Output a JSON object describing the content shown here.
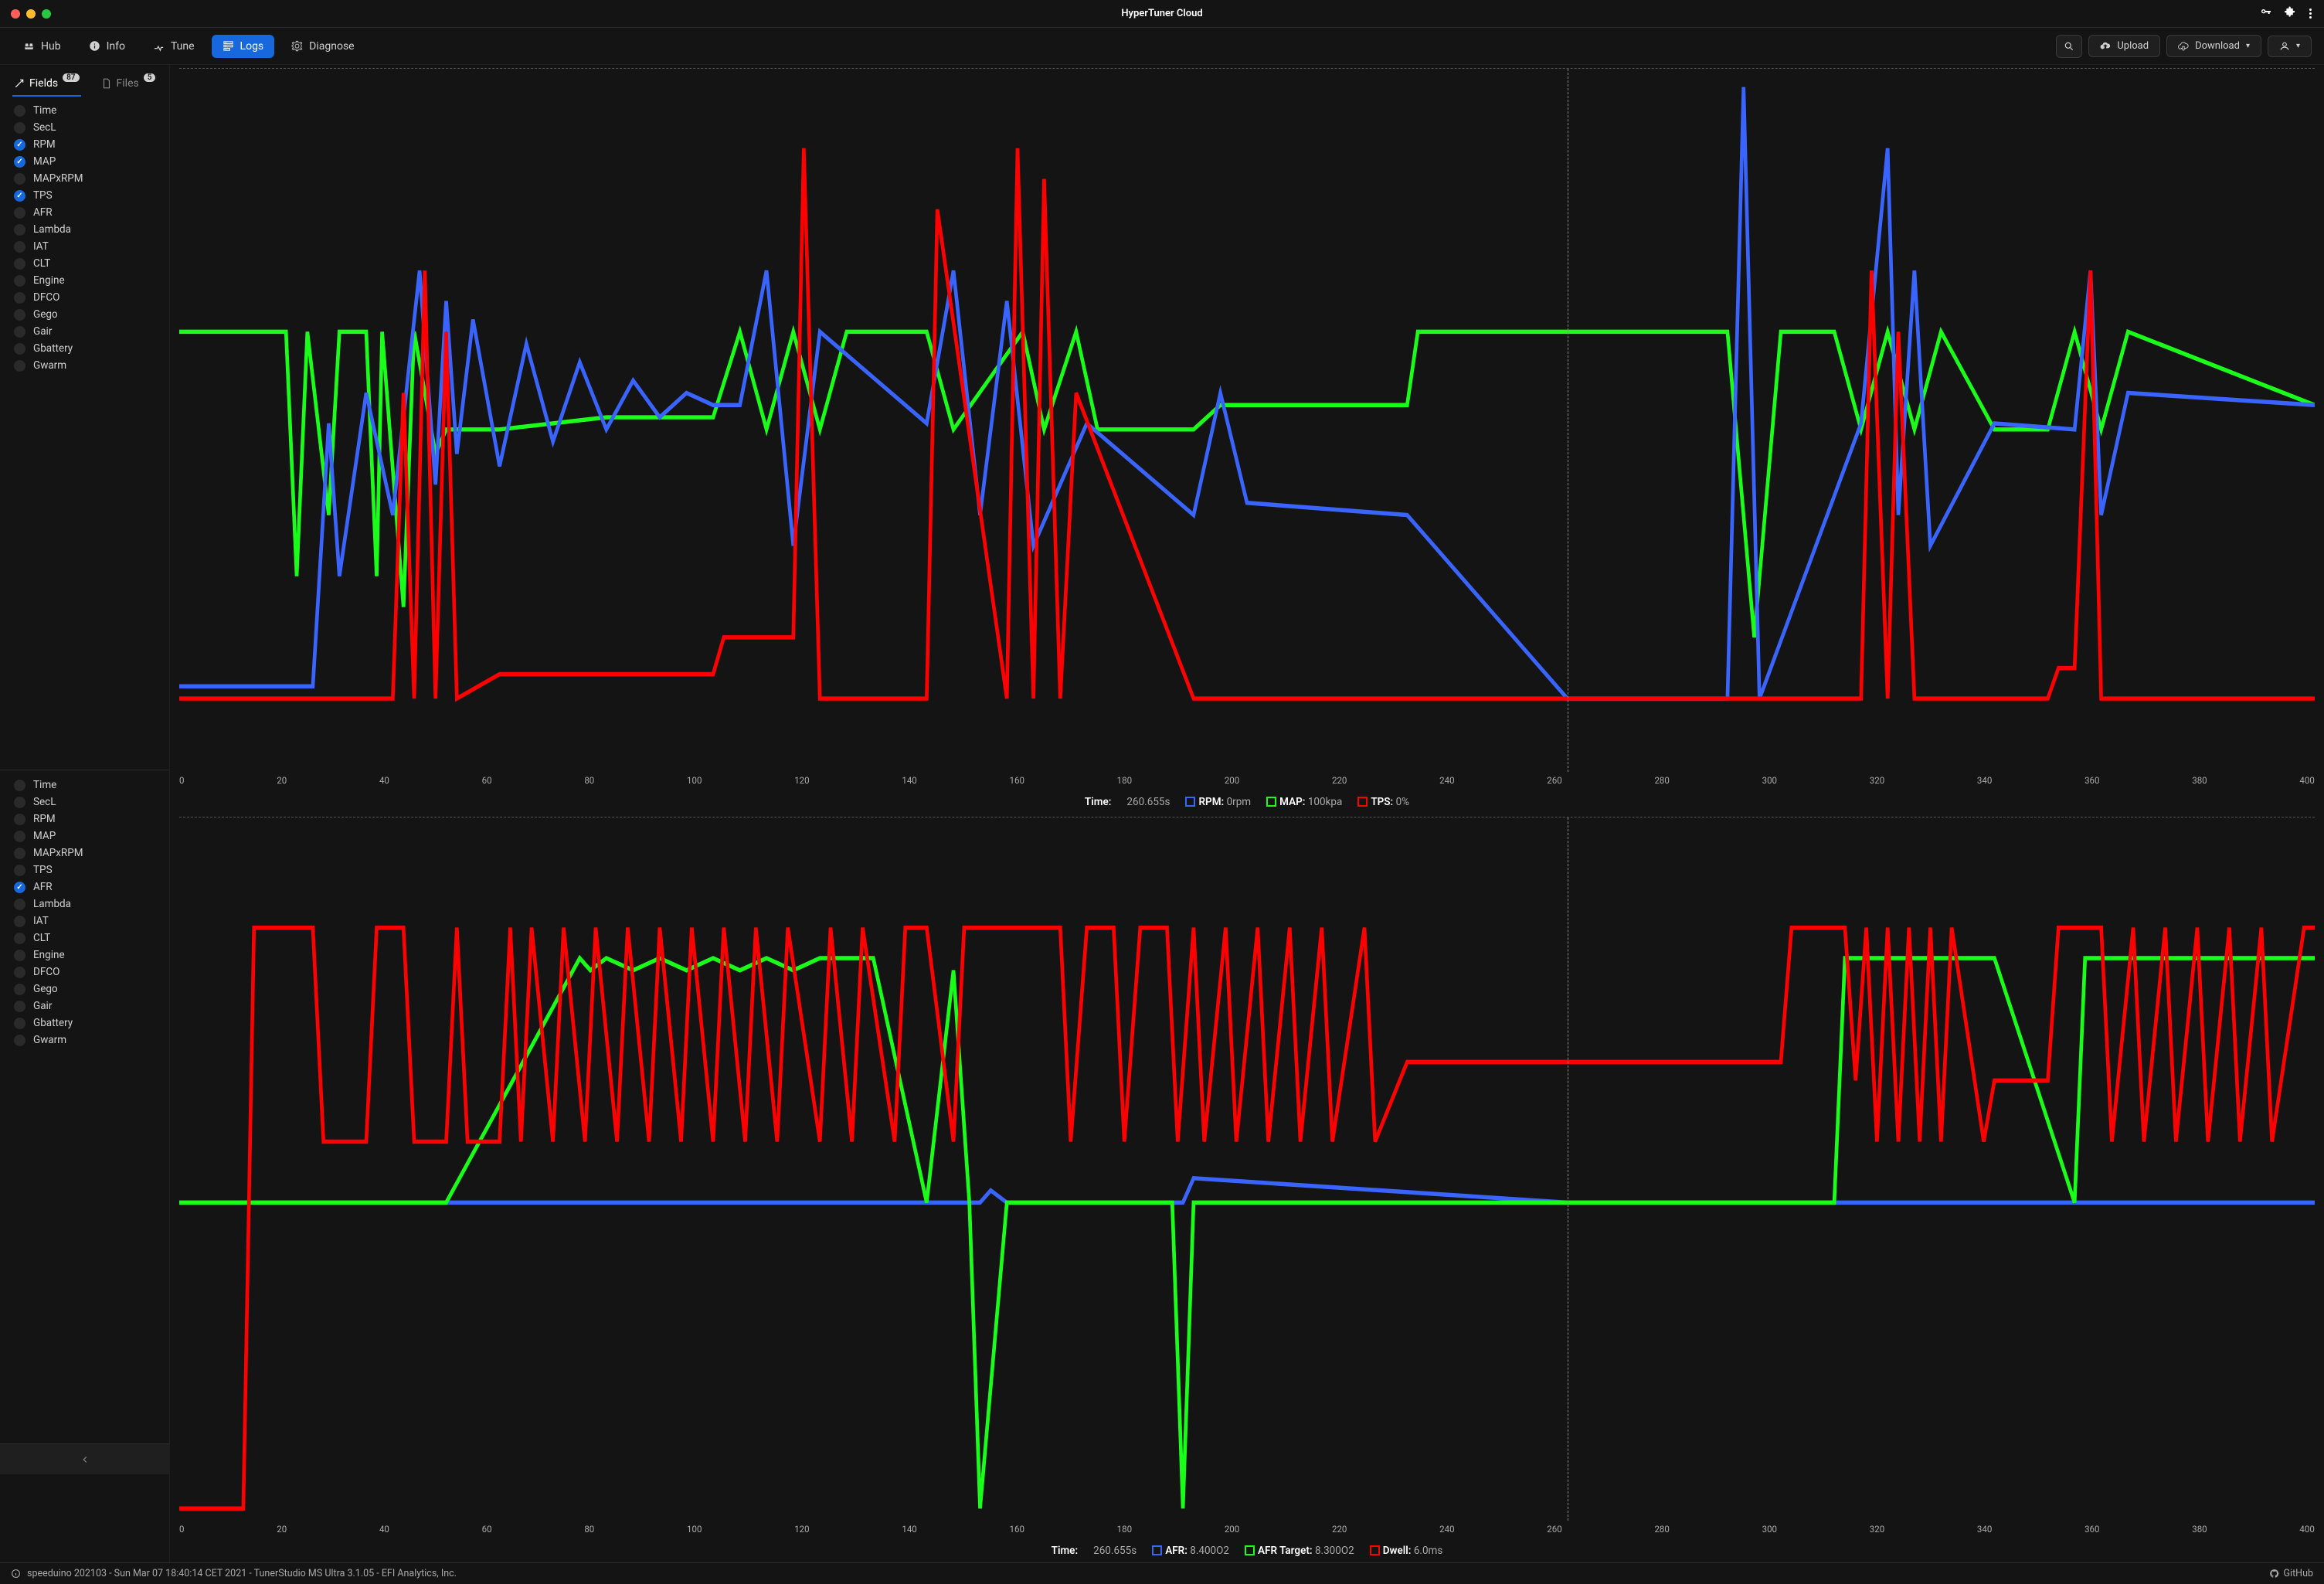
{
  "app": {
    "title": "HyperTuner Cloud"
  },
  "nav": {
    "hub": "Hub",
    "info": "Info",
    "tune": "Tune",
    "logs": "Logs",
    "diagnose": "Diagnose",
    "upload": "Upload",
    "download": "Download"
  },
  "sidebar": {
    "tabs": {
      "fields": "Fields",
      "fields_badge": "87",
      "files": "Files",
      "files_badge": "5"
    },
    "list1": [
      {
        "label": "Time",
        "on": false
      },
      {
        "label": "SecL",
        "on": false
      },
      {
        "label": "RPM",
        "on": true
      },
      {
        "label": "MAP",
        "on": true
      },
      {
        "label": "MAPxRPM",
        "on": false
      },
      {
        "label": "TPS",
        "on": true
      },
      {
        "label": "AFR",
        "on": false
      },
      {
        "label": "Lambda",
        "on": false
      },
      {
        "label": "IAT",
        "on": false
      },
      {
        "label": "CLT",
        "on": false
      },
      {
        "label": "Engine",
        "on": false
      },
      {
        "label": "DFCO",
        "on": false
      },
      {
        "label": "Gego",
        "on": false
      },
      {
        "label": "Gair",
        "on": false
      },
      {
        "label": "Gbattery",
        "on": false
      },
      {
        "label": "Gwarm",
        "on": false
      }
    ],
    "list2": [
      {
        "label": "Time",
        "on": false
      },
      {
        "label": "SecL",
        "on": false
      },
      {
        "label": "RPM",
        "on": false
      },
      {
        "label": "MAP",
        "on": false
      },
      {
        "label": "MAPxRPM",
        "on": false
      },
      {
        "label": "TPS",
        "on": false
      },
      {
        "label": "AFR",
        "on": true
      },
      {
        "label": "Lambda",
        "on": false
      },
      {
        "label": "IAT",
        "on": false
      },
      {
        "label": "CLT",
        "on": false
      },
      {
        "label": "Engine",
        "on": false
      },
      {
        "label": "DFCO",
        "on": false
      },
      {
        "label": "Gego",
        "on": false
      },
      {
        "label": "Gair",
        "on": false
      },
      {
        "label": "Gbattery",
        "on": false
      },
      {
        "label": "Gwarm",
        "on": false
      }
    ]
  },
  "status": {
    "text": "speeduino 202103 - Sun Mar 07 18:40:14 CET 2021 - TunerStudio MS Ultra 3.1.05 - EFI Analytics, Inc.",
    "github": "GitHub"
  },
  "chart_data": [
    {
      "type": "line",
      "xlim": [
        0,
        400
      ],
      "cursor_x": 260.655,
      "x_ticks": [
        "0",
        "20",
        "40",
        "60",
        "80",
        "100",
        "120",
        "140",
        "160",
        "180",
        "200",
        "220",
        "240",
        "260",
        "280",
        "300",
        "320",
        "340",
        "360",
        "380",
        "400"
      ],
      "legend": {
        "time_label": "Time:",
        "time_val": "260.655s",
        "items": [
          {
            "name": "RPM",
            "color": "#3a64ff",
            "value": "0rpm"
          },
          {
            "name": "MAP",
            "color": "#1aff1a",
            "value": "100kpa"
          },
          {
            "name": "TPS",
            "color": "#ff0000",
            "value": "0%"
          }
        ]
      },
      "series": [
        {
          "name": "MAP",
          "color": "#1aff1a",
          "x": [
            0,
            20,
            22,
            24,
            28,
            30,
            35,
            37,
            38,
            42,
            44,
            48,
            50,
            60,
            80,
            100,
            105,
            110,
            115,
            120,
            125,
            140,
            145,
            158,
            162,
            168,
            172,
            190,
            195,
            230,
            232,
            260,
            290,
            295,
            300,
            310,
            315,
            320,
            325,
            330,
            340,
            350,
            355,
            360,
            365,
            400
          ],
          "y": [
            60,
            60,
            20,
            60,
            30,
            60,
            60,
            20,
            60,
            15,
            60,
            40,
            44,
            44,
            46,
            46,
            60,
            44,
            60,
            44,
            60,
            60,
            44,
            60,
            44,
            60,
            44,
            44,
            48,
            48,
            60,
            60,
            60,
            10,
            60,
            60,
            44,
            60,
            44,
            60,
            44,
            44,
            60,
            44,
            60,
            48
          ]
        },
        {
          "name": "RPM",
          "color": "#3a64ff",
          "x": [
            0,
            25,
            28,
            30,
            35,
            40,
            45,
            48,
            50,
            52,
            55,
            60,
            65,
            70,
            75,
            80,
            85,
            90,
            95,
            100,
            105,
            110,
            115,
            120,
            140,
            145,
            150,
            155,
            160,
            170,
            190,
            195,
            200,
            230,
            260,
            290,
            293,
            296,
            315,
            320,
            322,
            325,
            328,
            340,
            355,
            358,
            360,
            365,
            400
          ],
          "y": [
            2,
            2,
            45,
            20,
            50,
            30,
            70,
            35,
            65,
            40,
            62,
            38,
            58,
            42,
            55,
            44,
            52,
            46,
            50,
            48,
            48,
            70,
            25,
            60,
            45,
            70,
            30,
            65,
            25,
            45,
            30,
            50,
            32,
            30,
            0,
            0,
            100,
            0,
            45,
            90,
            30,
            70,
            25,
            45,
            44,
            70,
            30,
            50,
            48
          ]
        },
        {
          "name": "TPS",
          "color": "#ff0000",
          "x": [
            0,
            40,
            42,
            44,
            46,
            48,
            50,
            52,
            60,
            70,
            100,
            102,
            115,
            117,
            120,
            140,
            142,
            155,
            157,
            160,
            162,
            165,
            168,
            190,
            192,
            260,
            315,
            317,
            320,
            322,
            325,
            350,
            352,
            355,
            358,
            360,
            400
          ],
          "y": [
            0,
            0,
            50,
            0,
            70,
            0,
            60,
            0,
            4,
            4,
            4,
            10,
            10,
            90,
            0,
            0,
            80,
            0,
            90,
            0,
            85,
            0,
            50,
            0,
            0,
            0,
            0,
            70,
            0,
            60,
            0,
            0,
            5,
            5,
            70,
            0,
            0
          ]
        }
      ]
    },
    {
      "type": "line",
      "xlim": [
        0,
        400
      ],
      "cursor_x": 260.655,
      "x_ticks": [
        "0",
        "20",
        "40",
        "60",
        "80",
        "100",
        "120",
        "140",
        "160",
        "180",
        "200",
        "220",
        "240",
        "260",
        "280",
        "300",
        "320",
        "340",
        "360",
        "380",
        "400"
      ],
      "legend": {
        "time_label": "Time:",
        "time_val": "260.655s",
        "items": [
          {
            "name": "AFR",
            "color": "#3a64ff",
            "value": "8.400O2"
          },
          {
            "name": "AFR Target",
            "color": "#1aff1a",
            "value": "8.300O2"
          },
          {
            "name": "Dwell",
            "color": "#ff0000",
            "value": "6.0ms"
          }
        ]
      },
      "series": [
        {
          "name": "AFR",
          "color": "#3a64ff",
          "x": [
            0,
            50,
            150,
            152,
            155,
            188,
            190,
            260,
            300,
            400
          ],
          "y": [
            40,
            40,
            40,
            42,
            40,
            40,
            44,
            40,
            40,
            40
          ]
        },
        {
          "name": "AFR Target",
          "color": "#1aff1a",
          "x": [
            0,
            50,
            75,
            77,
            80,
            85,
            90,
            95,
            100,
            105,
            110,
            115,
            120,
            130,
            140,
            145,
            148,
            150,
            155,
            186,
            188,
            190,
            230,
            260,
            300,
            310,
            312,
            340,
            355,
            357,
            400
          ],
          "y": [
            40,
            40,
            80,
            78,
            80,
            78,
            80,
            78,
            80,
            78,
            80,
            78,
            80,
            80,
            40,
            78,
            40,
            -10,
            40,
            40,
            -10,
            40,
            40,
            40,
            40,
            40,
            80,
            80,
            40,
            80,
            80
          ]
        },
        {
          "name": "Dwell",
          "color": "#ff0000",
          "x": [
            0,
            12,
            14,
            25,
            27,
            35,
            37,
            42,
            44,
            50,
            52,
            54,
            60,
            62,
            64,
            66,
            70,
            72,
            76,
            78,
            82,
            84,
            88,
            90,
            94,
            96,
            100,
            102,
            106,
            108,
            112,
            114,
            120,
            122,
            126,
            128,
            134,
            136,
            140,
            145,
            147,
            150,
            165,
            167,
            170,
            175,
            177,
            180,
            185,
            187,
            190,
            192,
            196,
            198,
            202,
            204,
            208,
            210,
            214,
            216,
            222,
            224,
            230,
            250,
            260,
            300,
            302,
            312,
            314,
            316,
            318,
            320,
            322,
            324,
            326,
            328,
            330,
            332,
            338,
            340,
            350,
            352,
            360,
            362,
            366,
            368,
            372,
            374,
            378,
            380,
            384,
            386,
            390,
            392,
            398,
            400
          ],
          "y": [
            -10,
            -10,
            85,
            85,
            50,
            50,
            85,
            85,
            50,
            50,
            85,
            50,
            50,
            85,
            50,
            85,
            50,
            85,
            50,
            85,
            50,
            85,
            50,
            85,
            50,
            85,
            50,
            85,
            50,
            85,
            50,
            85,
            50,
            85,
            50,
            85,
            50,
            85,
            85,
            50,
            85,
            85,
            85,
            50,
            85,
            85,
            50,
            85,
            85,
            50,
            85,
            50,
            85,
            50,
            85,
            50,
            85,
            50,
            85,
            50,
            85,
            50,
            63,
            63,
            63,
            63,
            85,
            85,
            60,
            85,
            50,
            85,
            50,
            85,
            50,
            85,
            50,
            85,
            50,
            60,
            60,
            85,
            85,
            50,
            85,
            50,
            85,
            50,
            85,
            50,
            85,
            50,
            85,
            50,
            85,
            85
          ]
        }
      ]
    }
  ]
}
